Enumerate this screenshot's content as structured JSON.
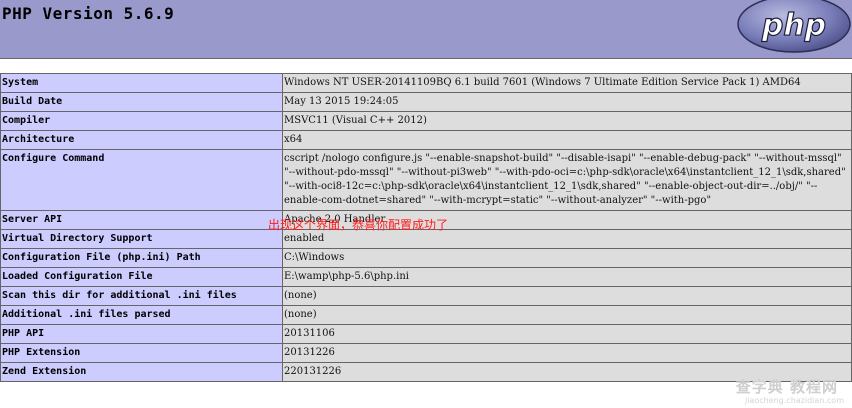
{
  "header": {
    "title": "PHP Version 5.6.9",
    "logo_text": "php"
  },
  "rows": [
    {
      "label": "System",
      "value": "Windows NT USER-20141109BQ 6.1 build 7601 (Windows 7 Ultimate Edition Service Pack 1) AMD64"
    },
    {
      "label": "Build Date",
      "value": "May 13 2015 19:24:05"
    },
    {
      "label": "Compiler",
      "value": "MSVC11 (Visual C++ 2012)"
    },
    {
      "label": "Architecture",
      "value": "x64"
    },
    {
      "label": "Configure Command",
      "value": "cscript /nologo configure.js \"--enable-snapshot-build\" \"--disable-isapi\" \"--enable-debug-pack\" \"--without-mssql\" \"--without-pdo-mssql\" \"--without-pi3web\" \"--with-pdo-oci=c:\\php-sdk\\oracle\\x64\\instantclient_12_1\\sdk,shared\" \"--with-oci8-12c=c:\\php-sdk\\oracle\\x64\\instantclient_12_1\\sdk,shared\" \"--enable-object-out-dir=../obj/\" \"--enable-com-dotnet=shared\" \"--with-mcrypt=static\" \"--without-analyzer\" \"--with-pgo\""
    },
    {
      "label": "Server API",
      "value": "Apache 2.0 Handler"
    },
    {
      "label": "Virtual Directory Support",
      "value": "enabled"
    },
    {
      "label": "Configuration File (php.ini) Path",
      "value": "C:\\Windows"
    },
    {
      "label": "Loaded Configuration File",
      "value": "E:\\wamp\\php-5.6\\php.ini"
    },
    {
      "label": "Scan this dir for additional .ini files",
      "value": "(none)"
    },
    {
      "label": "Additional .ini files parsed",
      "value": "(none)"
    },
    {
      "label": "PHP API",
      "value": "20131106"
    },
    {
      "label": "PHP Extension",
      "value": "20131226"
    },
    {
      "label": "Zend Extension",
      "value": "220131226"
    }
  ],
  "annotation": "出现这个界面，恭喜你配置成功了",
  "watermark": {
    "main": "查字典 教程网",
    "sub": "jiaocheng.chazidian.com"
  },
  "colors": {
    "header_bg": "#9999cc",
    "label_bg": "#ccccff",
    "value_bg": "#dddddd",
    "annotation": "#ff1a1a"
  }
}
